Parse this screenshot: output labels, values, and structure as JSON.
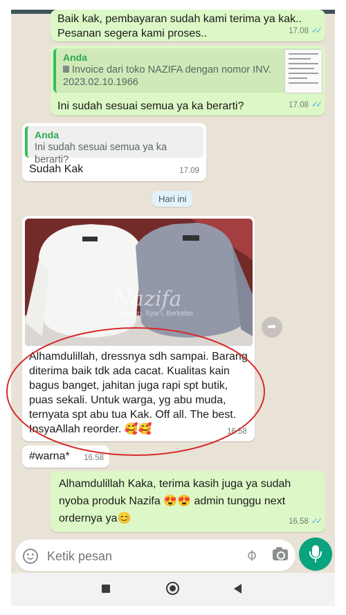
{
  "messages": {
    "m1": {
      "text": "Baik kak, pembayaran sudah kami terima ya kak.. Pesanan segera kami proses..",
      "time": "17.08",
      "status": "read"
    },
    "m2": {
      "quote_name": "Anda",
      "quote_text": "Invoice dari toko NAZIFA dengan nomor INV. 2023.02.10.1966",
      "text": "Ini sudah sesuai semua ya ka berarti?",
      "time": "17.08"
    },
    "m3": {
      "quote_name": "Anda",
      "quote_text": "Ini sudah sesuai semua ya ka berarti?",
      "text": "Sudah Kak",
      "time": "17.09"
    },
    "date_chip": "Hari ini",
    "m4": {
      "watermark": "Nazifa",
      "watermark_sub": "Anggun, Syar'i, Berkelas",
      "caption": "Alhamdulillah, dressnya sdh sampai. Barang diterima baik tdk ada cacat. Kualitas kain bagus banget, jahitan juga rapi spt butik, puas sekali. Untuk warga, yg abu muda, ternyata spt abu tua Kak. Off all. The best. InsyaAllah reorder. 🥰🥰",
      "time": "16.58"
    },
    "m5": {
      "text": "#warna*",
      "time": "16.58"
    },
    "m6": {
      "text": "Alhamdulillah Kaka, terima kasih juga ya sudah nyoba produk Nazifa 😍😍 admin tunggu next ordernya ya😊",
      "time": "16.58"
    }
  },
  "input": {
    "placeholder": "Ketik pesan"
  },
  "icons": [
    "emoji-icon",
    "attach-icon",
    "camera-icon",
    "mic-icon",
    "share-icon",
    "document-icon",
    "nav-square-icon",
    "nav-circle-icon",
    "nav-back-icon"
  ],
  "colors": {
    "outgoing": "#dcf8c6",
    "incoming": "#ffffff",
    "read_ticks": "#4fb6ec",
    "accent": "#0aa380",
    "quote_bar": "#35c05a"
  }
}
